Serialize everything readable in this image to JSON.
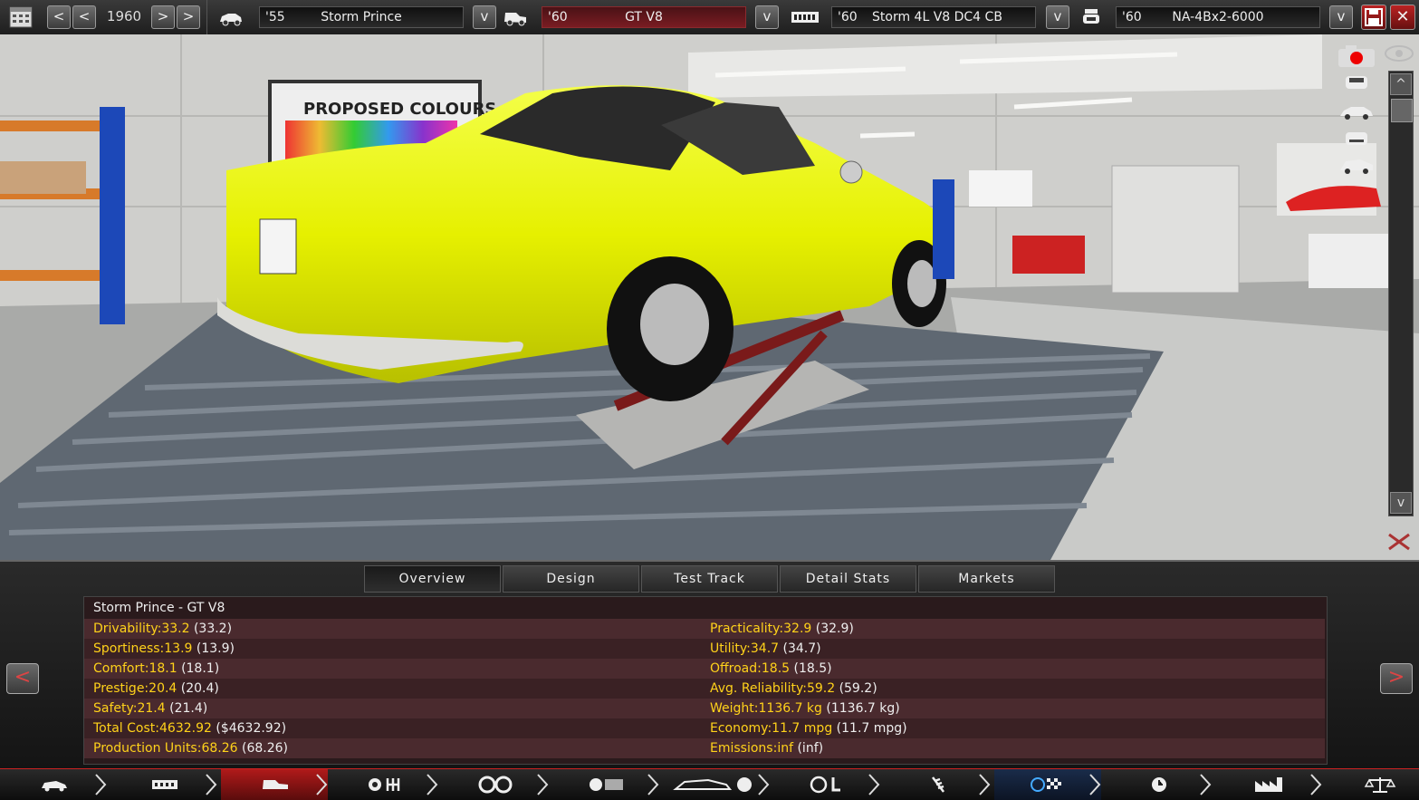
{
  "topbar": {
    "year": "1960",
    "model": {
      "year": "'55",
      "name": "Storm Prince"
    },
    "trim": {
      "year": "'60",
      "name": "GT V8"
    },
    "engine": {
      "year": "'60",
      "name": "Storm 4L V8 DC4 CB"
    },
    "engine_variant": {
      "year": "'60",
      "name": "NA-4Bx2-6000"
    },
    "prev_label": "<",
    "next_label": ">",
    "dropdown_label": "v"
  },
  "scene": {
    "poster_text": "PROPOSED COLOURS",
    "car_color": "#e6f000"
  },
  "tabs": [
    {
      "label": "Overview",
      "active": true
    },
    {
      "label": "Design",
      "active": false
    },
    {
      "label": "Test Track",
      "active": false
    },
    {
      "label": "Detail Stats",
      "active": false
    },
    {
      "label": "Markets",
      "active": false
    }
  ],
  "stats": {
    "title": "Storm Prince - GT V8",
    "left": [
      {
        "label": "Drivability:",
        "value": "33.2",
        "extra": "(33.2)"
      },
      {
        "label": "Sportiness:",
        "value": "13.9",
        "extra": "(13.9)"
      },
      {
        "label": "Comfort:",
        "value": "18.1",
        "extra": "(18.1)"
      },
      {
        "label": "Prestige:",
        "value": "20.4",
        "extra": "(20.4)"
      },
      {
        "label": "Safety:",
        "value": "21.4",
        "extra": "(21.4)"
      },
      {
        "label": "Total Cost:",
        "value": "4632.92",
        "extra": "($4632.92)"
      },
      {
        "label": "Production Units:",
        "value": "68.26",
        "extra": "(68.26)"
      }
    ],
    "right": [
      {
        "label": "Practicality:",
        "value": "32.9",
        "extra": "(32.9)"
      },
      {
        "label": "Utility:",
        "value": "34.7",
        "extra": "(34.7)"
      },
      {
        "label": "Offroad:",
        "value": "18.5",
        "extra": "(18.5)"
      },
      {
        "label": "Avg. Reliability:",
        "value": "59.2",
        "extra": "(59.2)"
      },
      {
        "label": "Weight:",
        "value": "1136.7 kg",
        "extra": "(1136.7 kg)"
      },
      {
        "label": "Economy:",
        "value": "11.7 mpg",
        "extra": "(11.7 mpg)"
      },
      {
        "label": "Emissions:",
        "value": "inf",
        "extra": "(inf)"
      }
    ]
  },
  "colors": {
    "accent_red": "#c22",
    "stat_label": "#ffd21a",
    "panel_bg": "#2a1a1c"
  },
  "bottom_nav_icons": [
    "car-icon",
    "chassis-icon",
    "body-icon",
    "gearbox-icon",
    "wheels-icon",
    "brakes-body-icon",
    "aero-icon",
    "interior-icon",
    "suspension-icon",
    "test-track-icon",
    "engineering-time-icon",
    "factory-icon",
    "markets-scale-icon"
  ]
}
